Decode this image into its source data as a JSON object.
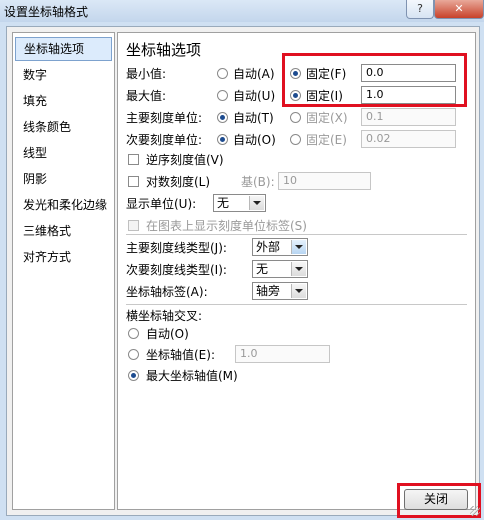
{
  "window": {
    "title": "设置坐标轴格式",
    "help_glyph": "?",
    "close_glyph": "✕"
  },
  "sidebar": {
    "items": [
      {
        "label": "坐标轴选项",
        "selected": true
      },
      {
        "label": "数字"
      },
      {
        "label": "填充"
      },
      {
        "label": "线条颜色"
      },
      {
        "label": "线型"
      },
      {
        "label": "阴影"
      },
      {
        "label": "发光和柔化边缘"
      },
      {
        "label": "三维格式"
      },
      {
        "label": "对齐方式"
      }
    ]
  },
  "panel": {
    "heading": "坐标轴选项",
    "min": {
      "label": "最小值:",
      "auto": "自动(A)",
      "fixed": "固定(F)",
      "value": "0.0",
      "selected": "fixed"
    },
    "max": {
      "label": "最大值:",
      "auto": "自动(U)",
      "fixed": "固定(I)",
      "value": "1.0",
      "selected": "fixed"
    },
    "major_unit": {
      "label": "主要刻度单位:",
      "auto": "自动(T)",
      "fixed": "固定(X)",
      "value": "0.1",
      "selected": "auto"
    },
    "minor_unit": {
      "label": "次要刻度单位:",
      "auto": "自动(O)",
      "fixed": "固定(E)",
      "value": "0.02",
      "selected": "auto"
    },
    "reverse_label": "逆序刻度值(V)",
    "log_label": "对数刻度(L)",
    "log_base_label": "基(B):",
    "log_base_value": "10",
    "display_unit_label": "显示单位(U):",
    "display_unit_value": "无",
    "show_unit_label": "在图表上显示刻度单位标签(S)",
    "major_tick_label": "主要刻度线类型(J):",
    "major_tick_value": "外部",
    "minor_tick_label": "次要刻度线类型(I):",
    "minor_tick_value": "无",
    "axis_labels_label": "坐标轴标签(A):",
    "axis_labels_value": "轴旁",
    "cross_heading": "横坐标轴交叉:",
    "cross_auto": "自动(O)",
    "cross_value_label": "坐标轴值(E):",
    "cross_value": "1.0",
    "cross_max": "最大坐标轴值(M)",
    "cross_selected": "max"
  },
  "footer": {
    "close_label": "关闭"
  },
  "colors": {
    "highlight": "#e01020",
    "selection": "#dcebfc",
    "radio_dot": "#1d4b8f"
  }
}
